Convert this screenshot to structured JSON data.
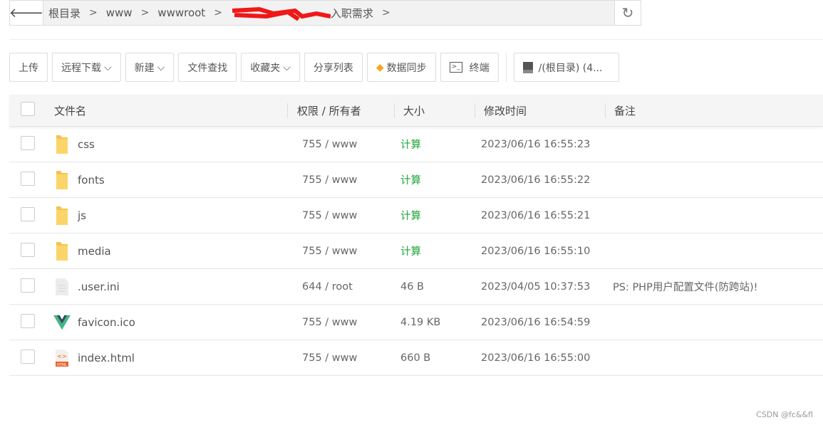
{
  "breadcrumb": {
    "items": [
      "根目录",
      "www",
      "wwwroot",
      "入职需求"
    ]
  },
  "toolbar": {
    "upload": "上传",
    "remote_download": "远程下载",
    "new": "新建",
    "file_search": "文件查找",
    "favorites": "收藏夹",
    "share_list": "分享列表",
    "data_sync": "数据同步",
    "terminal": "终端",
    "disk": "/(根目录) (4..."
  },
  "table": {
    "headers": {
      "name": "文件名",
      "perm": "权限 / 所有者",
      "size": "大小",
      "mtime": "修改时间",
      "note": "备注"
    },
    "rows": [
      {
        "name": "css",
        "perm": "755 / www",
        "size": "计算",
        "mtime": "2023/06/16 16:55:23",
        "note": ""
      },
      {
        "name": "fonts",
        "perm": "755 / www",
        "size": "计算",
        "mtime": "2023/06/16 16:55:22",
        "note": ""
      },
      {
        "name": "js",
        "perm": "755 / www",
        "size": "计算",
        "mtime": "2023/06/16 16:55:21",
        "note": ""
      },
      {
        "name": "media",
        "perm": "755 / www",
        "size": "计算",
        "mtime": "2023/06/16 16:55:10",
        "note": ""
      },
      {
        "name": ".user.ini",
        "perm": "644 / root",
        "size": "46 B",
        "mtime": "2023/04/05 10:37:53",
        "note": "PS: PHP用户配置文件(防跨站)!"
      },
      {
        "name": "favicon.ico",
        "perm": "755 / www",
        "size": "4.19 KB",
        "mtime": "2023/06/16 16:54:59",
        "note": ""
      },
      {
        "name": "index.html",
        "perm": "755 / www",
        "size": "660 B",
        "mtime": "2023/06/16 16:55:00",
        "note": ""
      }
    ]
  },
  "watermark": "CSDN @fc&&fl"
}
